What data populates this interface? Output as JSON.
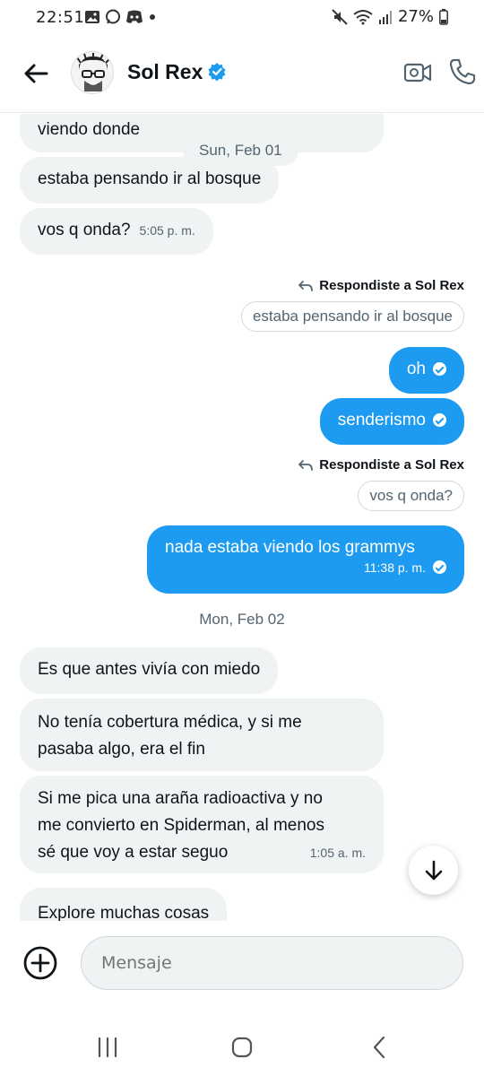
{
  "status_bar": {
    "time": "22:51",
    "battery": "27%",
    "icons": [
      "image-icon",
      "chat-icon",
      "discord-icon",
      "dot-icon",
      "mute-icon",
      "wifi-icon",
      "signal-icon",
      "battery-icon"
    ]
  },
  "header": {
    "contact_name": "Sol Rex",
    "verified": true,
    "icons": [
      "back-arrow-icon",
      "verified-badge-icon",
      "video-call-icon",
      "phone-icon"
    ]
  },
  "messages": {
    "m1_text": "viendo donde",
    "date_chip_1": "Sun, Feb 01",
    "m2_text": "estaba pensando ir al bosque",
    "m3_text": "vos q onda?",
    "m3_time": "5:05 p. m.",
    "reply_label_1": "Respondiste a Sol Rex",
    "quote_1": "estaba pensando ir al bosque",
    "m4_text": "oh",
    "m5_text": "senderismo",
    "reply_label_2": "Respondiste a Sol Rex",
    "quote_2": "vos q onda?",
    "m6_text": "nada estaba viendo los grammys",
    "m6_time": "11:38 p. m.",
    "date_sep_2": "Mon, Feb 02",
    "m7_text": "Es que antes vivía con miedo",
    "m8_line1": "No tenía cobertura médica, y si me",
    "m8_line2": "pasaba algo, era el fin",
    "m9_line1": "Si me pica una araña radioactiva y no",
    "m9_line2": "me convierto en Spiderman, al menos",
    "m9_line3": "sé que voy a estar seguo",
    "m9_time": "1:05 a. m.",
    "m10_text": "Explore muchas cosas"
  },
  "composer": {
    "placeholder": "Mensaje"
  },
  "colors": {
    "accent": "#1d9bf0",
    "incoming_bubble": "#eff3f4",
    "secondary_text": "#536471"
  }
}
